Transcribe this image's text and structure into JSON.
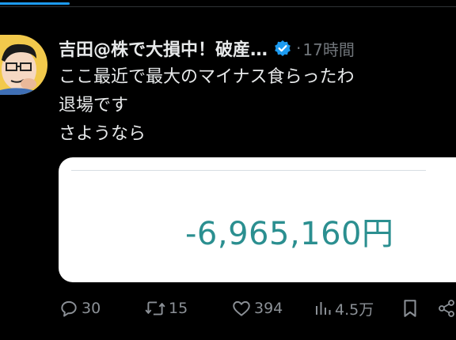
{
  "tweet": {
    "display_name": "吉田@株で大損中！破産…",
    "time_separator": "·",
    "time": "17時間",
    "text_lines": [
      "ここ最近で最大のマイナス食らったわ",
      "退場です",
      "さようなら"
    ],
    "card": {
      "amount": "-6,965,160円"
    }
  },
  "actions": {
    "replies": "30",
    "retweets": "15",
    "likes": "394",
    "views": "4.5万"
  },
  "icons": {
    "verified": "verified-badge-icon",
    "reply": "reply-icon",
    "retweet": "retweet-icon",
    "like": "heart-icon",
    "views": "views-bar-chart-icon",
    "bookmark": "bookmark-icon",
    "share": "share-icon"
  },
  "colors": {
    "background": "#000000",
    "text": "#e7e9ea",
    "muted": "#71767b",
    "accent": "#1d9bf0",
    "amount": "#2b8f90"
  }
}
